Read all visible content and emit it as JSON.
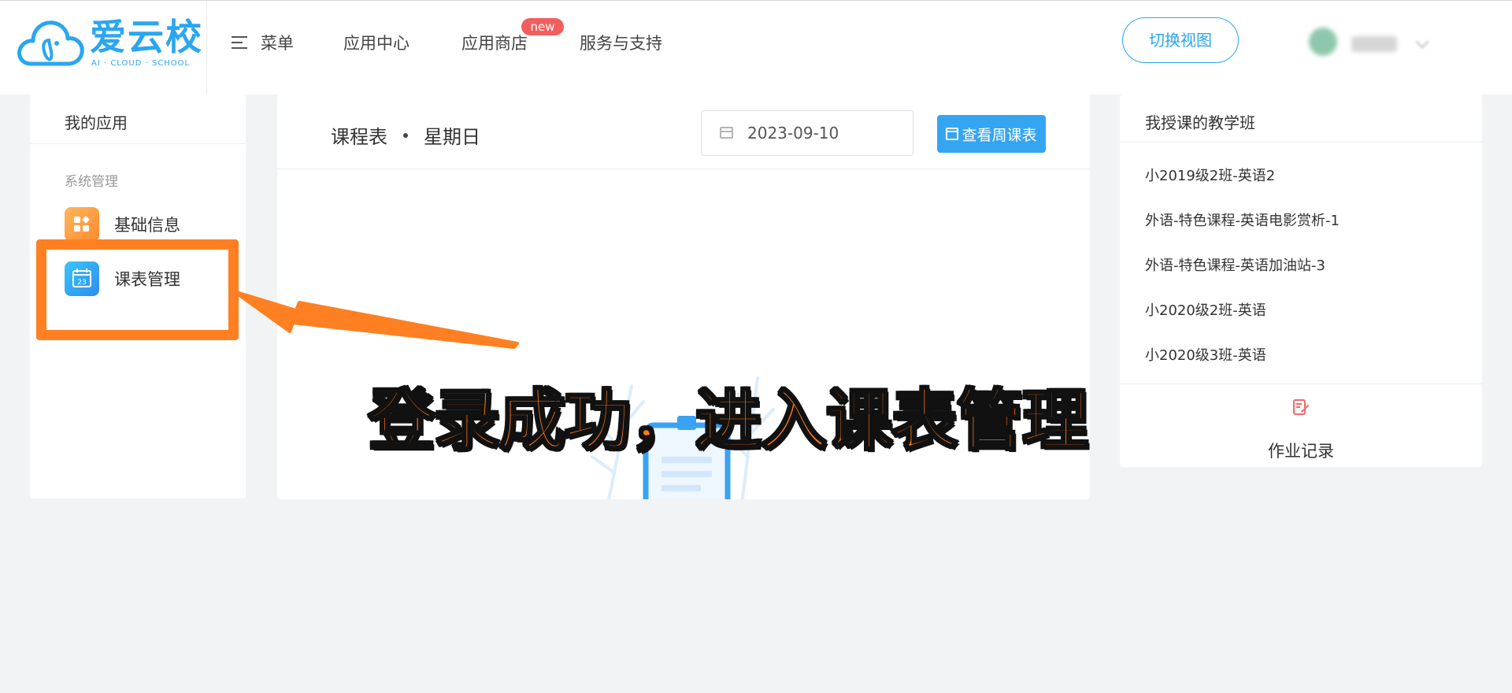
{
  "logo": {
    "title": "爱云校",
    "subtitle": "AI · CLOUD · SCHOOL"
  },
  "nav": {
    "menu": "菜单",
    "app_center": "应用中心",
    "app_store": "应用商店",
    "app_store_badge": "new",
    "service": "服务与支持"
  },
  "header": {
    "switch_view": "切换视图"
  },
  "left_panel": {
    "title": "我的应用",
    "section": "系统管理",
    "items": [
      {
        "label": "基础信息",
        "icon": "grid-icon"
      },
      {
        "label": "课表管理",
        "icon": "calendar-icon"
      }
    ]
  },
  "center": {
    "title": "课程表",
    "day": "星期日",
    "date": "2023-09-10",
    "week_button": "查看周课表"
  },
  "right_panel": {
    "title": "我授课的教学班",
    "classes": [
      "小2019级2班-英语2",
      "外语-特色课程-英语电影赏析-1",
      "外语-特色课程-英语加油站-3",
      "小2020级2班-英语",
      "小2020级3班-英语"
    ],
    "homework": "作业记录"
  },
  "overlay": {
    "caption": "登录成功，进入课表管理"
  },
  "colors": {
    "brand": "#2aa6f1",
    "accent_orange": "#ff8022",
    "badge_red": "#f25e5e",
    "button_blue": "#35a5f2"
  }
}
